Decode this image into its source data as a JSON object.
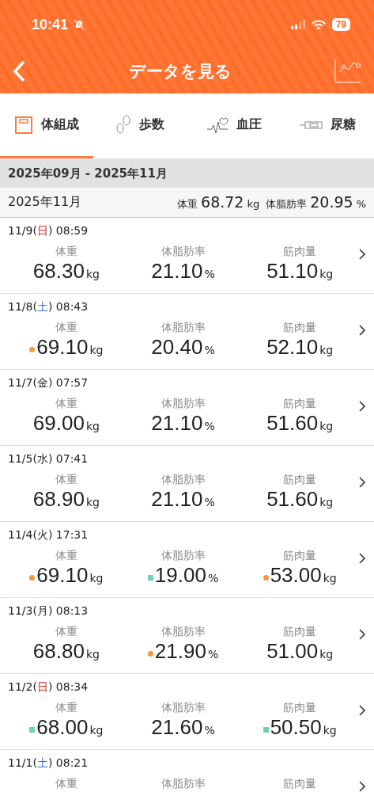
{
  "status_bar": {
    "time": "10:41",
    "battery": "79"
  },
  "header": {
    "title": "データを見る"
  },
  "tabs": [
    {
      "label": "体組成",
      "kind": "scale",
      "selected": true
    },
    {
      "label": "歩数",
      "kind": "steps",
      "selected": false
    },
    {
      "label": "血圧",
      "kind": "pressure",
      "selected": false
    },
    {
      "label": "尿糖",
      "kind": "glucose",
      "selected": false
    }
  ],
  "range": "2025年09月 - 2025年11月",
  "summary": {
    "month": "2025年11月",
    "items": [
      {
        "label": "体重",
        "value": "68.72",
        "unit": "kg"
      },
      {
        "label": "体脂肪率",
        "value": "20.95",
        "unit": "%"
      }
    ]
  },
  "records": [
    {
      "date_prefix": "11/9(",
      "weekday": {
        "text": "日",
        "color": "#e22222"
      },
      "date_suffix": ") 08:59",
      "metrics": [
        {
          "label": "体重",
          "value": "68.30",
          "unit": "kg",
          "high": false,
          "low": false
        },
        {
          "label": "体脂肪率",
          "value": "21.10",
          "unit": "%",
          "high": false,
          "low": false
        },
        {
          "label": "筋肉量",
          "value": "51.10",
          "unit": "kg",
          "high": false,
          "low": false
        }
      ]
    },
    {
      "date_prefix": "11/8(",
      "weekday": {
        "text": "土",
        "color": "#3a6fd8"
      },
      "date_suffix": ") 08:43",
      "metrics": [
        {
          "label": "体重",
          "value": "69.10",
          "unit": "kg",
          "high": true,
          "low": false
        },
        {
          "label": "体脂肪率",
          "value": "20.40",
          "unit": "%",
          "high": false,
          "low": false
        },
        {
          "label": "筋肉量",
          "value": "52.10",
          "unit": "kg",
          "high": false,
          "low": false
        }
      ]
    },
    {
      "date_prefix": "11/7(",
      "weekday": {
        "text": "金"
      },
      "date_suffix": ") 07:57",
      "metrics": [
        {
          "label": "体重",
          "value": "69.00",
          "unit": "kg",
          "high": false,
          "low": false
        },
        {
          "label": "体脂肪率",
          "value": "21.10",
          "unit": "%",
          "high": false,
          "low": false
        },
        {
          "label": "筋肉量",
          "value": "51.60",
          "unit": "kg",
          "high": false,
          "low": false
        }
      ]
    },
    {
      "date_prefix": "11/5(",
      "weekday": {
        "text": "水"
      },
      "date_suffix": ") 07:41",
      "metrics": [
        {
          "label": "体重",
          "value": "68.90",
          "unit": "kg",
          "high": false,
          "low": false
        },
        {
          "label": "体脂肪率",
          "value": "21.10",
          "unit": "%",
          "high": false,
          "low": false
        },
        {
          "label": "筋肉量",
          "value": "51.60",
          "unit": "kg",
          "high": false,
          "low": false
        }
      ]
    },
    {
      "date_prefix": "11/4(",
      "weekday": {
        "text": "火"
      },
      "date_suffix": ") 17:31",
      "metrics": [
        {
          "label": "体重",
          "value": "69.10",
          "unit": "kg",
          "high": true,
          "low": false
        },
        {
          "label": "体脂肪率",
          "value": "19.00",
          "unit": "%",
          "high": false,
          "low": true
        },
        {
          "label": "筋肉量",
          "value": "53.00",
          "unit": "kg",
          "high": true,
          "low": false
        }
      ]
    },
    {
      "date_prefix": "11/3(",
      "weekday": {
        "text": "月"
      },
      "date_suffix": ") 08:13",
      "metrics": [
        {
          "label": "体重",
          "value": "68.80",
          "unit": "kg",
          "high": false,
          "low": false
        },
        {
          "label": "体脂肪率",
          "value": "21.90",
          "unit": "%",
          "high": true,
          "low": false
        },
        {
          "label": "筋肉量",
          "value": "51.00",
          "unit": "kg",
          "high": false,
          "low": false
        }
      ]
    },
    {
      "date_prefix": "11/2(",
      "weekday": {
        "text": "日",
        "color": "#e22222"
      },
      "date_suffix": ") 08:34",
      "metrics": [
        {
          "label": "体重",
          "value": "68.00",
          "unit": "kg",
          "high": false,
          "low": true
        },
        {
          "label": "体脂肪率",
          "value": "21.60",
          "unit": "%",
          "high": false,
          "low": false
        },
        {
          "label": "筋肉量",
          "value": "50.50",
          "unit": "kg",
          "high": false,
          "low": true
        }
      ]
    },
    {
      "date_prefix": "11/1(",
      "weekday": {
        "text": "土",
        "color": "#3a6fd8"
      },
      "date_suffix": ") 08:21",
      "metrics": [
        {
          "label": "体重"
        },
        {
          "label": "体脂肪率"
        },
        {
          "label": "筋肉量"
        }
      ]
    }
  ]
}
